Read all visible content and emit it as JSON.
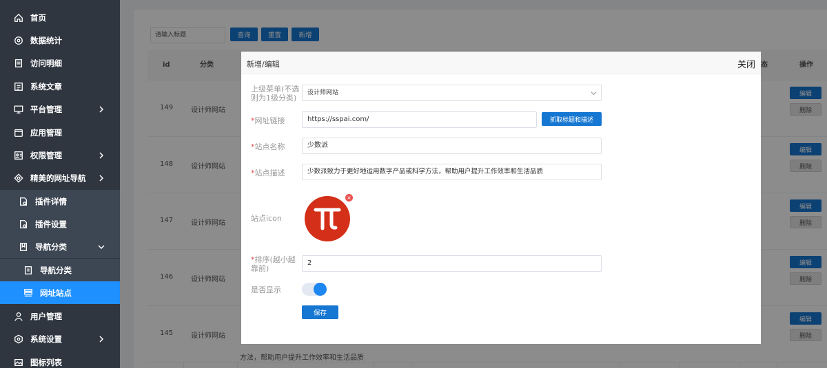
{
  "sidebar": {
    "items": [
      {
        "label": "首页",
        "icon": "home-icon"
      },
      {
        "label": "数据统计",
        "icon": "stats-icon"
      },
      {
        "label": "访问明细",
        "icon": "doc-icon"
      },
      {
        "label": "系统文章",
        "icon": "article-icon"
      },
      {
        "label": "平台管理",
        "icon": "monitor-icon"
      },
      {
        "label": "应用管理",
        "icon": "app-icon"
      },
      {
        "label": "权限管理",
        "icon": "permission-icon"
      },
      {
        "label": "精美的网址导航",
        "icon": "nav-icon"
      },
      {
        "label": "插件详情",
        "icon": "plugin-icon"
      },
      {
        "label": "插件设置",
        "icon": "plugin-settings-icon"
      },
      {
        "label": "导航分类",
        "icon": "book-icon"
      },
      {
        "label": "导航分类",
        "icon": "category-icon"
      },
      {
        "label": "网址站点",
        "icon": "list-icon"
      },
      {
        "label": "用户管理",
        "icon": "user-icon"
      },
      {
        "label": "系统设置",
        "icon": "settings-icon"
      },
      {
        "label": "图标列表",
        "icon": "icons-icon"
      }
    ]
  },
  "toolbar": {
    "search_placeholder": "请输入标题",
    "query_label": "查询",
    "reset_label": "重置",
    "add_label": "新增"
  },
  "table": {
    "headers": {
      "id": "id",
      "category": "分类",
      "col_partial": "态",
      "actions": "操作"
    },
    "rows": [
      {
        "id": "149",
        "category": "设计师网站"
      },
      {
        "id": "148",
        "category": "设计师网站"
      },
      {
        "id": "147",
        "category": "设计师网站"
      },
      {
        "id": "146",
        "category": "设计师网站"
      },
      {
        "id": "145",
        "category": "设计师网站"
      }
    ],
    "edit_label": "编辑",
    "delete_label": "删除",
    "trailing_text": "方法，帮助用户提升工作效率和生活品质"
  },
  "modal": {
    "title": "新增/编辑",
    "close_label": "关闭",
    "parent_menu_label": "上级菜单(不选则为1级分类)",
    "parent_menu_value": "设计师网站",
    "url_label": "网址链接",
    "url_value": "https://sspai.com/",
    "fetch_label": "抓取标题和描述",
    "name_label": "站点名称",
    "name_value": "少数派",
    "desc_label": "站点描述",
    "desc_value": "少数派致力于更好地运用数字产品或科学方法，帮助用户提升工作效率和生活品质",
    "icon_label": "站点icon",
    "icon_remove": "×",
    "sort_label": "排序(越小越靠前)",
    "sort_value": "2",
    "show_label": "是否显示",
    "show_enabled": true,
    "save_label": "保存",
    "required_mark": "*"
  },
  "colors": {
    "sidebar_bg": "#2f3640",
    "active": "#1e90ff",
    "primary_button": "#1677d2",
    "icon_bg": "#d42f18",
    "required": "#e94b4b"
  }
}
